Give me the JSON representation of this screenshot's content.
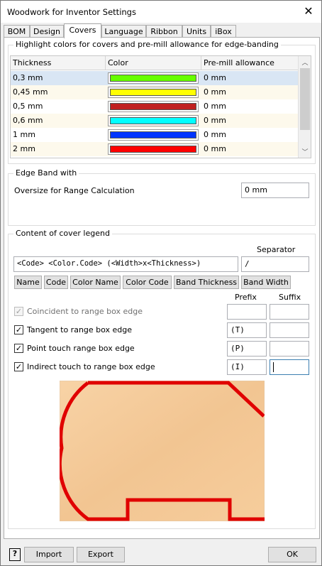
{
  "window": {
    "title": "Woodwork for Inventor Settings"
  },
  "tabs": [
    {
      "label": "BOM"
    },
    {
      "label": "Design"
    },
    {
      "label": "Covers",
      "active": true
    },
    {
      "label": "Language"
    },
    {
      "label": "Ribbon"
    },
    {
      "label": "Units"
    },
    {
      "label": "iBox"
    }
  ],
  "highlight": {
    "title": "Highlight colors for covers and pre-mill allowance for edge-banding",
    "columns": [
      "Thickness",
      "Color",
      "Pre-mill allowance"
    ],
    "rows": [
      {
        "thickness": "0,3 mm",
        "color": "#66ff00",
        "allowance": "0 mm"
      },
      {
        "thickness": "0,45 mm",
        "color": "#ffff00",
        "allowance": "0 mm"
      },
      {
        "thickness": "0,5 mm",
        "color": "#c02020",
        "allowance": "0 mm"
      },
      {
        "thickness": "0,6 mm",
        "color": "#00ffff",
        "allowance": "0 mm"
      },
      {
        "thickness": "1 mm",
        "color": "#0033ff",
        "allowance": "0 mm"
      },
      {
        "thickness": "2 mm",
        "color": "#ff0000",
        "allowance": "0 mm"
      },
      {
        "thickness": "",
        "color": "#ff00ff",
        "allowance": ""
      }
    ]
  },
  "edgeband": {
    "title": "Edge Band with",
    "oversize_label": "Oversize for Range Calculation",
    "oversize_value": "0 mm"
  },
  "legend": {
    "title": "Content of cover legend",
    "separator_label": "Separator",
    "format_value": "<Code> <Color.Code> (<Width>x<Thickness>)",
    "separator_value": "/",
    "tokens": [
      "Name",
      "Code",
      "Color Name",
      "Color Code",
      "Band Thickness",
      "Band Width"
    ],
    "prefix_label": "Prefix",
    "suffix_label": "Suffix",
    "options": [
      {
        "label": "Coincident to range box edge",
        "checked": true,
        "disabled": true,
        "prefix": "",
        "suffix": ""
      },
      {
        "label": "Tangent to range box edge",
        "checked": true,
        "disabled": false,
        "prefix": "(T)",
        "suffix": ""
      },
      {
        "label": "Point touch range box edge",
        "checked": true,
        "disabled": false,
        "prefix": "(P)",
        "suffix": ""
      },
      {
        "label": "Indirect touch to range box edge",
        "checked": true,
        "disabled": false,
        "prefix": "(I)",
        "suffix": ""
      }
    ]
  },
  "footer": {
    "help_icon": "help-icon",
    "help_glyph": "?",
    "import_label": "Import",
    "export_label": "Export",
    "ok_label": "OK"
  },
  "colors": {
    "accent": "#3c7fb1",
    "preview_edge": "#e00000",
    "preview_wood": "#f4c99a"
  }
}
